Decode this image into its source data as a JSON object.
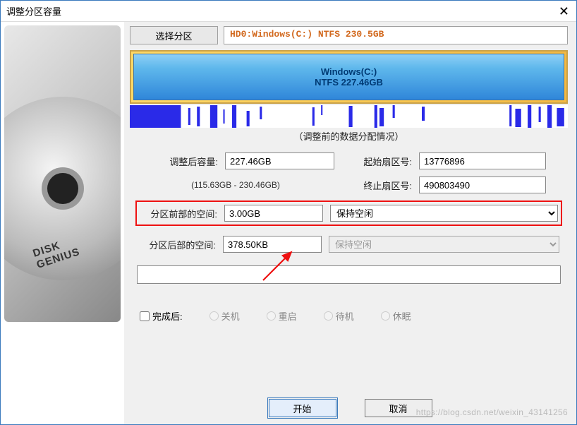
{
  "window": {
    "title": "调整分区容量"
  },
  "sidebar": {
    "brand": "DISK GENIUS"
  },
  "select": {
    "button_label": "选择分区",
    "value": "HD0:Windows(C:) NTFS 230.5GB"
  },
  "partition_bar": {
    "name": "Windows(C:)",
    "info": "NTFS 227.46GB"
  },
  "caption": "（调整前的数据分配情况）",
  "fields": {
    "size_after_label": "调整后容量:",
    "size_after_value": "227.46GB",
    "size_range": "(115.63GB - 230.46GB)",
    "start_sector_label": "起始扇区号:",
    "start_sector_value": "13776896",
    "end_sector_label": "终止扇区号:",
    "end_sector_value": "490803490",
    "front_space_label": "分区前部的空间:",
    "front_space_value": "3.00GB",
    "front_space_action": "保持空闲",
    "rear_space_label": "分区后部的空间:",
    "rear_space_value": "378.50KB",
    "rear_space_action": "保持空闲"
  },
  "after": {
    "checkbox_label": "完成后:",
    "options": [
      "关机",
      "重启",
      "待机",
      "休眠"
    ]
  },
  "buttons": {
    "start": "开始",
    "cancel": "取消"
  },
  "watermark": "https://blog.csdn.net/weixin_43141256"
}
